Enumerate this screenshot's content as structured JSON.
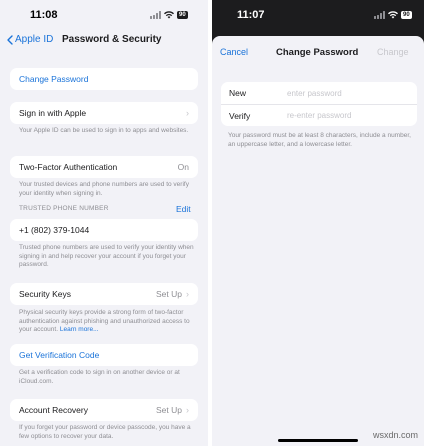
{
  "left": {
    "status": {
      "time": "11:08",
      "battery": "90"
    },
    "nav": {
      "back_label": "Apple ID",
      "title": "Password & Security"
    },
    "change_password": "Change Password",
    "sign_in_with_apple": {
      "label": "Sign in with Apple",
      "footnote": "Your Apple ID can be used to sign in to apps and websites."
    },
    "two_factor": {
      "label": "Two-Factor Authentication",
      "value": "On",
      "footnote": "Your trusted devices and phone numbers are used to verify your identity when signing in."
    },
    "trusted_phone": {
      "header": "TRUSTED PHONE NUMBER",
      "edit_label": "Edit",
      "number": "+1 (802) 379-1044",
      "footnote": "Trusted phone numbers are used to verify your identity when signing in and help recover your account if you forget your password."
    },
    "security_keys": {
      "label": "Security Keys",
      "value": "Set Up",
      "footnote": "Physical security keys provide a strong form of two-factor authentication against phishing and unauthorized access to your account.",
      "learn_more": "Learn more..."
    },
    "verification": {
      "label": "Get Verification Code",
      "footnote": "Get a verification code to sign in on another device or at iCloud.com."
    },
    "account_recovery": {
      "label": "Account Recovery",
      "value": "Set Up",
      "footnote": "If you forget your password or device passcode, you have a few options to recover your data."
    }
  },
  "right": {
    "status": {
      "time": "11:07",
      "battery": "90"
    },
    "sheet": {
      "cancel_label": "Cancel",
      "title": "Change Password",
      "change_label": "Change"
    },
    "fields": {
      "new_label": "New",
      "new_placeholder": "enter password",
      "new_value": "",
      "verify_label": "Verify",
      "verify_placeholder": "re-enter password",
      "verify_value": ""
    },
    "hint": "Your password must be at least 8 characters, include a number, an uppercase letter, and a lowercase letter."
  },
  "watermark": "wsxdn.com",
  "icons": [
    "signal-icon",
    "wifi-icon",
    "battery-icon",
    "back-chevron-icon",
    "chevron-right-icon"
  ],
  "colors": {
    "accent": "#1a73d9",
    "background": "#f2f2f7",
    "secondary_text": "#8e8e93"
  }
}
